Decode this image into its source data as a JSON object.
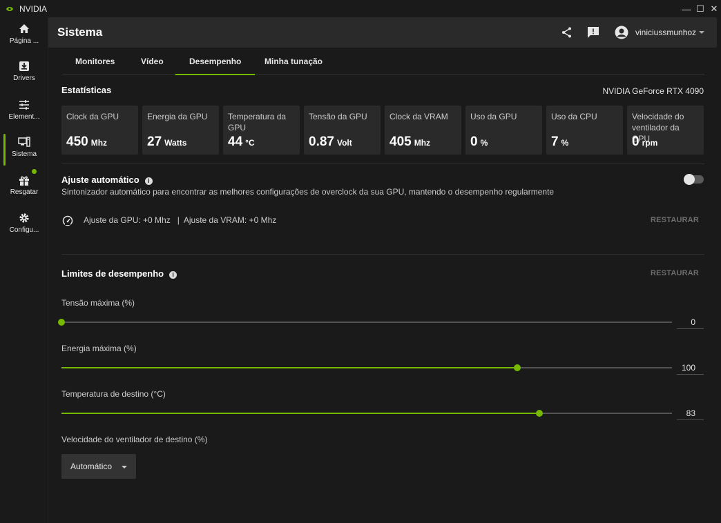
{
  "window": {
    "title": "NVIDIA",
    "controls": [
      "minimize",
      "maximize",
      "close"
    ]
  },
  "sidebar": {
    "items": [
      {
        "label": "Página ...",
        "icon": "home-icon"
      },
      {
        "label": "Drivers",
        "icon": "download-icon"
      },
      {
        "label": "Element...",
        "icon": "sliders-icon"
      },
      {
        "label": "Sistema",
        "icon": "system-icon",
        "active": true
      },
      {
        "label": "Resgatar",
        "icon": "gift-icon",
        "badge": true
      },
      {
        "label": "Configu...",
        "icon": "gear-icon"
      }
    ]
  },
  "header": {
    "title": "Sistema",
    "username": "viniciussmunhoz",
    "icons": [
      "share-icon",
      "feedback-icon",
      "avatar-icon"
    ]
  },
  "tabs": [
    {
      "label": "Monitores"
    },
    {
      "label": "Vídeo"
    },
    {
      "label": "Desempenho",
      "active": true
    },
    {
      "label": "Minha tunação"
    }
  ],
  "stats": {
    "title": "Estatísticas",
    "gpu_name": "NVIDIA GeForce RTX 4090",
    "cards": [
      {
        "label": "Clock da GPU",
        "value": "450",
        "unit": "Mhz"
      },
      {
        "label": "Energia da GPU",
        "value": "27",
        "unit": "Watts"
      },
      {
        "label": "Temperatura da GPU",
        "value": "44",
        "unit": "°C"
      },
      {
        "label": "Tensão da GPU",
        "value": "0.87",
        "unit": "Volt"
      },
      {
        "label": "Clock da VRAM",
        "value": "405",
        "unit": "Mhz"
      },
      {
        "label": "Uso da GPU",
        "value": "0",
        "unit": "%"
      },
      {
        "label": "Uso da CPU",
        "value": "7",
        "unit": "%"
      },
      {
        "label": "Velocidade do ventilador da GPU",
        "value": "0",
        "unit": "rpm"
      }
    ]
  },
  "auto_tune": {
    "title": "Ajuste automático",
    "description": "Sintonizador automático para encontrar as melhores configurações de overclock da sua GPU, mantendo o desempenho regularmente",
    "enabled": false,
    "status": "Ajuste da GPU: +0 Mhz   |  Ajuste da VRAM: +0 Mhz",
    "restore_label": "RESTAURAR"
  },
  "limits": {
    "title": "Limites de desempenho",
    "restore_label": "RESTAURAR",
    "sliders": [
      {
        "label": "Tensão máxima (%)",
        "value": "0",
        "fraction": 0.0
      },
      {
        "label": "Energia máxima (%)",
        "value": "100",
        "fraction": 0.747
      },
      {
        "label": "Temperatura de destino (°C)",
        "value": "83",
        "fraction": 0.783
      }
    ],
    "fan": {
      "label": "Velocidade do ventilador de destino (%)",
      "selected": "Automático"
    }
  },
  "colors": {
    "accent": "#76b900",
    "panel": "#2a2a2a",
    "background": "#1a1a1a"
  }
}
